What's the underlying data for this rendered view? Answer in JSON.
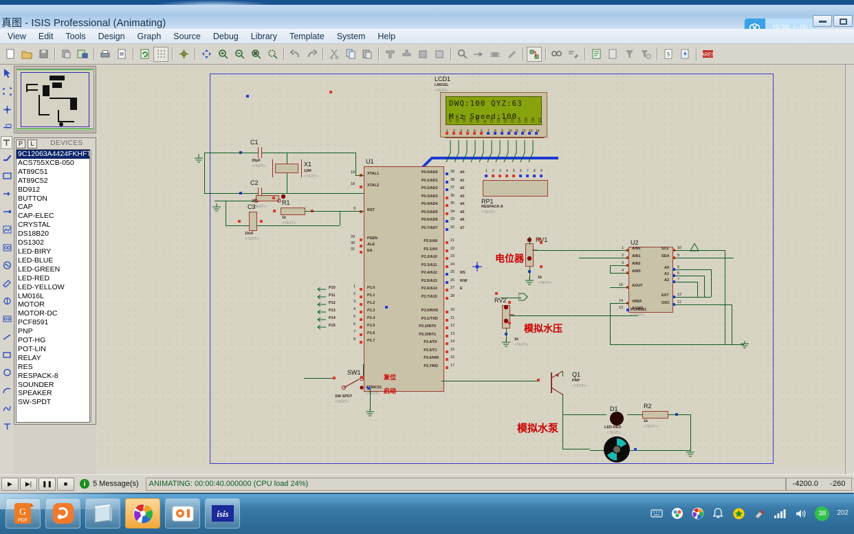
{
  "window": {
    "title": "真图 - ISIS Professional (Animating)",
    "cloud_widget_label": "拖拽上传",
    "cloud_icon": "cloud-icon",
    "minimize_label": "Minimize",
    "maximize_label": "Maximize"
  },
  "menu": {
    "items": [
      "View",
      "Edit",
      "Tools",
      "Design",
      "Graph",
      "Source",
      "Debug",
      "Library",
      "Template",
      "System",
      "Help"
    ]
  },
  "toolbar": {
    "groups": [
      [
        "new-file-icon",
        "open-folder-icon",
        "save-icon"
      ],
      [
        "import-icon",
        "export-icon"
      ],
      [
        "print-icon",
        "print-area-icon"
      ],
      [
        "refresh-icon",
        "grid-icon"
      ],
      [
        "origin-icon"
      ],
      [
        "pan-icon",
        "zoom-in-icon",
        "zoom-out-icon",
        "zoom-area-icon",
        "zoom-all-icon"
      ],
      [
        "undo-icon",
        "redo-icon"
      ],
      [
        "cut-icon",
        "copy-icon",
        "paste-icon"
      ],
      [
        "block-copy-icon",
        "block-move-icon",
        "block-rotate-icon",
        "block-delete-icon"
      ],
      [
        "pick-device-icon",
        "make-device-icon",
        "package-icon",
        "decompose-icon"
      ],
      [
        "wire-autorouter-icon"
      ],
      [
        "search-tag-icon",
        "property-assign-icon"
      ],
      [
        "design-explorer-icon",
        "new-sheet-icon",
        "remove-sheet-icon",
        "exit-sheet-icon"
      ],
      [
        "bill-of-materials-icon",
        "electrical-rules-icon"
      ],
      [
        "ares-netlist-icon"
      ]
    ]
  },
  "left_rail": {
    "icons": [
      "selection-mode-icon",
      "component-mode-icon",
      "junction-dot-icon",
      "wire-label-icon",
      "text-script-icon",
      "bus-icon",
      "subcircuit-icon",
      "terminals-icon",
      "device-pin-icon",
      "graph-icon",
      "tape-recorder-icon",
      "generator-icon",
      "voltage-probe-icon",
      "current-probe-icon",
      "virtual-instrument-icon",
      "line-tool-icon",
      "box-tool-icon",
      "circle-tool-icon",
      "arc-tool-icon",
      "path-tool-icon",
      "text-tool-icon",
      "symbol-tool-icon",
      "marker-tool-icon",
      "rotate-cw-icon",
      "rotate-ccw-icon",
      "mirror-x-icon",
      "mirror-y-icon"
    ]
  },
  "devices_panel": {
    "p_button": "P",
    "l_button": "L",
    "title": "DEVICES",
    "selected_index": 0,
    "items": [
      "9C12063A4424FKHFT",
      "ACS755XCB-050",
      "AT89C51",
      "AT89C52",
      "BD912",
      "BUTTON",
      "CAP",
      "CAP-ELEC",
      "CRYSTAL",
      "DS18B20",
      "DS1302",
      "LED-BIRY",
      "LED-BLUE",
      "LED-GREEN",
      "LED-RED",
      "LED-YELLOW",
      "LM016L",
      "MOTOR",
      "MOTOR-DC",
      "PCF8591",
      "PNP",
      "POT-HG",
      "POT-LIN",
      "RELAY",
      "RES",
      "RESPACK-8",
      "SOUNDER",
      "SPEAKER",
      "SW-SPDT"
    ]
  },
  "schematic": {
    "lcd": {
      "ref": "LCD1",
      "part": "LM016L",
      "text_tag": "<TEXT>",
      "line1": "DWQ:100 QYZ:63",
      "line2": "M-z  Speed:100",
      "pin_labels": [
        "VSS",
        "VDD",
        "VEE",
        "RS",
        "RW",
        "E",
        "D0",
        "D1",
        "D2",
        "D3",
        "D4",
        "D5",
        "D6",
        "D7"
      ]
    },
    "mcu": {
      "ref": "U1",
      "part": "AT89C51",
      "text_tag": "<TEXT>",
      "left_pins": [
        {
          "num": "19",
          "name": "XTAL1"
        },
        {
          "num": "18",
          "name": "XTAL2"
        },
        {
          "num": "9",
          "name": "RST"
        },
        {
          "num": "29",
          "name": "PSEN"
        },
        {
          "num": "30",
          "name": "ALE"
        },
        {
          "num": "31",
          "name": "EA"
        },
        {
          "num": "1",
          "name": "P1.0"
        },
        {
          "num": "2",
          "name": "P1.1"
        },
        {
          "num": "3",
          "name": "P1.2"
        },
        {
          "num": "4",
          "name": "P1.3"
        },
        {
          "num": "5",
          "name": "P1.4"
        },
        {
          "num": "6",
          "name": "P1.5"
        },
        {
          "num": "7",
          "name": "P1.6"
        },
        {
          "num": "8",
          "name": "P1.7"
        }
      ],
      "left_net_labels": [
        "P10",
        "P11",
        "P12",
        "P13",
        "P14",
        "P15"
      ],
      "right_pins_p0": [
        {
          "num": "39",
          "name": "P0.0/AD0",
          "net": "d0"
        },
        {
          "num": "38",
          "name": "P0.1/AD1",
          "net": "d1"
        },
        {
          "num": "37",
          "name": "P0.2/AD2",
          "net": "d2"
        },
        {
          "num": "36",
          "name": "P0.3/AD3",
          "net": "d3"
        },
        {
          "num": "35",
          "name": "P0.4/AD4",
          "net": "d4"
        },
        {
          "num": "34",
          "name": "P0.5/AD5",
          "net": "d5"
        },
        {
          "num": "33",
          "name": "P0.6/AD6",
          "net": "d6"
        },
        {
          "num": "32",
          "name": "P0.7/AD7",
          "net": "d7"
        }
      ],
      "right_pins_p2": [
        {
          "num": "21",
          "name": "P2.0/A8",
          "net": ""
        },
        {
          "num": "22",
          "name": "P2.1/A9",
          "net": ""
        },
        {
          "num": "23",
          "name": "P2.2/A10",
          "net": ""
        },
        {
          "num": "24",
          "name": "P2.3/A11",
          "net": ""
        },
        {
          "num": "25",
          "name": "P2.4/A12",
          "net": "RS"
        },
        {
          "num": "26",
          "name": "P2.5/A13",
          "net": "R/W"
        },
        {
          "num": "27",
          "name": "P2.6/A14",
          "net": "E"
        },
        {
          "num": "28",
          "name": "P2.7/A15",
          "net": ""
        }
      ],
      "right_pins_p3": [
        {
          "num": "10",
          "name": "P3.0/RXD"
        },
        {
          "num": "11",
          "name": "P3.1/TXD"
        },
        {
          "num": "12",
          "name": "P3.2/INT0"
        },
        {
          "num": "13",
          "name": "P3.3/INT1"
        },
        {
          "num": "14",
          "name": "P3.4/T0"
        },
        {
          "num": "15",
          "name": "P3.5/T1"
        },
        {
          "num": "16",
          "name": "P3.6/WR"
        },
        {
          "num": "17",
          "name": "P3.7/RD"
        }
      ]
    },
    "adc": {
      "ref": "U2",
      "part": "PCF8591",
      "text_tag": "<TEXT>",
      "left_pins": [
        {
          "num": "1",
          "name": "AIN0"
        },
        {
          "num": "2",
          "name": "AIN1"
        },
        {
          "num": "3",
          "name": "AIN2"
        },
        {
          "num": "4",
          "name": "AIN3"
        },
        {
          "num": "15",
          "name": "AOUT"
        },
        {
          "num": "14",
          "name": "VREF"
        },
        {
          "num": "13",
          "name": "AGND"
        }
      ],
      "right_pins": [
        {
          "num": "10",
          "name": "SCL"
        },
        {
          "num": "9",
          "name": "SDA"
        },
        {
          "num": "5",
          "name": "A0"
        },
        {
          "num": "6",
          "name": "A1"
        },
        {
          "num": "7",
          "name": "A2"
        },
        {
          "num": "12",
          "name": "EXT"
        },
        {
          "num": "11",
          "name": "OSC"
        }
      ]
    },
    "components": [
      {
        "ref": "C1",
        "value": "20pF",
        "text_tag": "<TEXT>"
      },
      {
        "ref": "C2",
        "value": "20pF",
        "text_tag": "<TEXT>"
      },
      {
        "ref": "C3",
        "value": "10uF",
        "text_tag": "<TEXT>"
      },
      {
        "ref": "X1",
        "value": "12M",
        "text_tag": "<TEXT>"
      },
      {
        "ref": "R1",
        "value": "1k",
        "text_tag": "<TEXT>"
      },
      {
        "ref": "R2",
        "value": "1k",
        "text_tag": "<TEXT>"
      },
      {
        "ref": "RP1",
        "value": "RESPACK-8",
        "text_tag": "<TEXT>"
      },
      {
        "ref": "RV1",
        "value": "1k",
        "text_tag": "<TEXT>"
      },
      {
        "ref": "RV2",
        "value": "1k",
        "text_tag": "<TEXT>"
      },
      {
        "ref": "SW1",
        "value": "SW-SPDT",
        "text_tag": "<TEXT>"
      },
      {
        "ref": "Q1",
        "value": "PNP",
        "text_tag": "<TEXT>"
      },
      {
        "ref": "D1",
        "value": "LED-RED",
        "text_tag": "<TEXT>"
      }
    ],
    "annotations": [
      {
        "text": "电位器",
        "meaning": "potentiometer"
      },
      {
        "text": "模拟水压",
        "meaning": "simulated-water-pressure"
      },
      {
        "text": "模拟水泵",
        "meaning": "simulated-water-pump"
      }
    ],
    "net_labels_sw1": [
      "复位",
      "启动"
    ]
  },
  "statusbar": {
    "play_label": "▶",
    "step_label": "▶|",
    "pause_label": "❚❚",
    "stop_label": "■",
    "message_count": "5 Message(s)",
    "info_icon": "info-icon",
    "animating_text": "ANIMATING: 00:00:40.000000 (CPU load 24%)",
    "coord_x": "-4200.0",
    "coord_y": "-260"
  },
  "taskbar": {
    "apps": [
      {
        "name": "wps-pdf-icon",
        "label": "PDF"
      },
      {
        "name": "uc-browser-icon",
        "label": "UC"
      },
      {
        "name": "notepad-icon",
        "label": ""
      },
      {
        "name": "photo-viewer-icon",
        "label": ""
      },
      {
        "name": "camera-icon",
        "label": ""
      },
      {
        "name": "isis-proteus-icon",
        "label": "isis"
      }
    ],
    "active_index": 3,
    "tray_icons": [
      "keyboard-icon",
      "ime-icon",
      "photos-icon",
      "bell-icon",
      "shield-icon",
      "usb-icon",
      "signal-icon",
      "volume-icon"
    ],
    "tray_badge": "38",
    "clock": "202"
  },
  "colors": {
    "title_blue": "#17518f",
    "wire_green": "#0a5c1f",
    "body_maroon": "#9e3b31",
    "body_fill": "#c8c2a8",
    "pin_red": "#d93a2b",
    "pin_blue": "#2a3ad0",
    "lcd_green": "#86a20d",
    "annotation_red": "#cc0000",
    "canvas_bg": "#d8d4c4",
    "chrome": "#d8d5cd",
    "selection_blue": "#0a246a"
  }
}
